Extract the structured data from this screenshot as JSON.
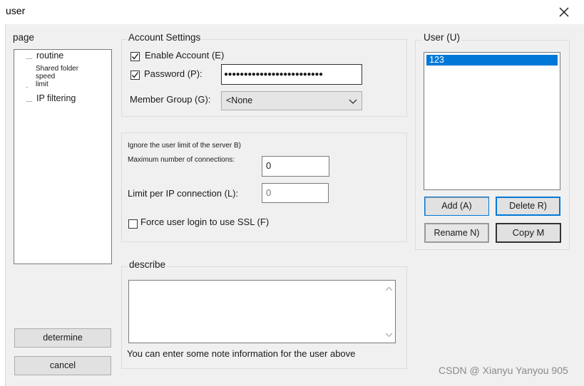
{
  "window": {
    "title": "user",
    "close_icon": "close-icon"
  },
  "page_panel": {
    "label": "page",
    "items": [
      {
        "label": "routine"
      },
      {
        "label": "Shared folder speed limit",
        "lines": [
          "Shared folder",
          "speed",
          "limit"
        ]
      },
      {
        "label": "IP filtering"
      }
    ]
  },
  "account_settings": {
    "label": "Account Settings",
    "enable_account": {
      "label": "Enable Account (E)",
      "checked": true
    },
    "password": {
      "label": "Password (P):",
      "checked": true,
      "mask": "●●●●●●●●●●●●●●●●●●●●●●●●●"
    },
    "member_group": {
      "label": "Member Group (G):",
      "value": "<None"
    }
  },
  "limits": {
    "ignore_limit_label": "Ignore the user limit of the server B)",
    "max_connections": {
      "label": "Maximum number of connections:",
      "value": "0"
    },
    "per_ip": {
      "label": "Limit per IP connection (L):",
      "value": "0"
    },
    "force_ssl": {
      "label": "Force user login to use SSL (F)",
      "checked": false
    }
  },
  "describe": {
    "label": "describe",
    "value": "",
    "hint": "You can enter some note information for the user above"
  },
  "user_panel": {
    "label": "User (U)",
    "users": [
      "123"
    ],
    "add_button": "Add (A)",
    "delete_button": "Delete R)",
    "rename_button": "Rename N)",
    "copy_button": "Copy M"
  },
  "footer_buttons": {
    "determine": "determine",
    "cancel": "cancel"
  },
  "watermark": "CSDN @ Xianyu Yanyou 905",
  "colors": {
    "selection": "#0078d7",
    "client_bg": "#f0f0f0",
    "focus_border": "#0078d7"
  }
}
